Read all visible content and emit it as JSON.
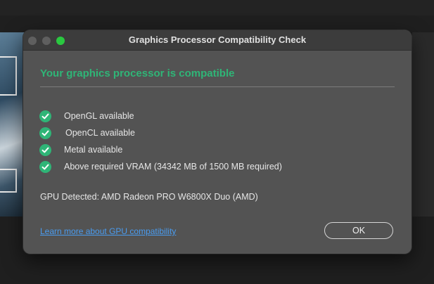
{
  "dialog": {
    "title": "Graphics Processor Compatibility Check",
    "heading": "Your graphics processor is compatible",
    "checks": [
      {
        "label": "OpenGL available",
        "icon": "check-circle-icon"
      },
      {
        "label": "OpenCL available",
        "icon": "check-circle-icon"
      },
      {
        "label": "Metal available",
        "icon": "check-circle-icon"
      },
      {
        "label": "Above required VRAM (34342 MB of 1500 MB required)",
        "icon": "check-circle-icon"
      }
    ],
    "gpu_detected": "GPU Detected: AMD Radeon PRO W6800X Duo (AMD)",
    "learn_more_link": "Learn more about GPU compatibility",
    "ok_label": "OK"
  },
  "colors": {
    "success": "#2fb577",
    "link": "#4a9cf0",
    "dialog_bg": "#535353",
    "titlebar_bg": "#3c3c3c",
    "maximize_button": "#2ac840"
  }
}
